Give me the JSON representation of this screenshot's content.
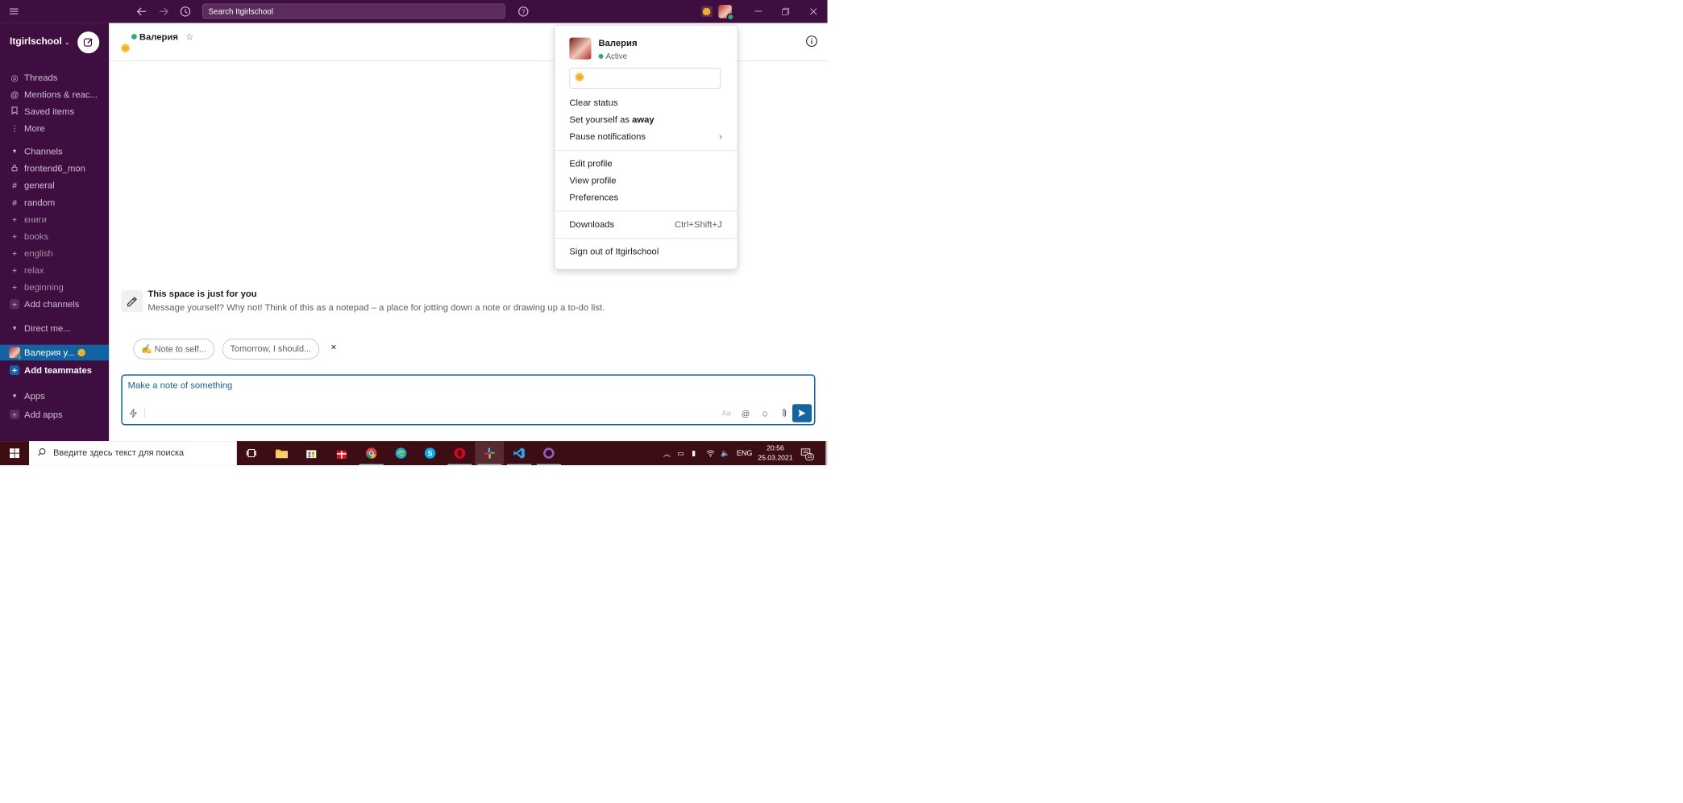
{
  "topbar": {
    "search_placeholder": "Search Itgirlschool"
  },
  "workspace": {
    "name": "Itgirlschool"
  },
  "sidebar": {
    "nav": [
      {
        "label": "Threads",
        "icon": "threads-icon"
      },
      {
        "label": "Mentions & reac...",
        "icon": "at-icon"
      },
      {
        "label": "Saved items",
        "icon": "bookmark-icon"
      },
      {
        "label": "More",
        "icon": "more-vertical-icon"
      }
    ],
    "channels_header": "Channels",
    "channels": [
      {
        "prefix": "🔒",
        "label": "frontend6_mon"
      },
      {
        "prefix": "#",
        "label": "general"
      },
      {
        "prefix": "#",
        "label": "random"
      },
      {
        "prefix": "+",
        "label": "книги"
      },
      {
        "prefix": "+",
        "label": "books"
      },
      {
        "prefix": "+",
        "label": "english"
      },
      {
        "prefix": "+",
        "label": "relax"
      },
      {
        "prefix": "+",
        "label": "beginning"
      }
    ],
    "add_channels": "Add channels",
    "dm_header": "Direct me...",
    "dm_self": "Валерия   y...",
    "add_teammates": "Add teammates",
    "apps_header": "Apps",
    "add_apps": "Add apps"
  },
  "channel": {
    "name": "Валерия",
    "status_emoji": "🌼"
  },
  "intro": {
    "title": "This space is just for you",
    "text": "Message yourself? Why not! Think of this as a notepad – a place for jotting down a note or drawing up a to-do list."
  },
  "chips": [
    {
      "label": "✍️  Note to self..."
    },
    {
      "label": "Tomorrow, I should..."
    }
  ],
  "chips_close": "×",
  "composer": {
    "placeholder": "Make a note of something",
    "format_label": "Aa"
  },
  "profile_menu": {
    "name": "Валерия",
    "status": "Active",
    "status_emoji": "🌼",
    "clear_status": "Clear status",
    "set_away_prefix": "Set yourself as ",
    "set_away_bold": "away",
    "pause_notifications": "Pause notifications",
    "edit_profile": "Edit profile",
    "view_profile": "View profile",
    "preferences": "Preferences",
    "downloads": "Downloads",
    "downloads_shortcut": "Ctrl+Shift+J",
    "sign_out": "Sign out of Itgirlschool"
  },
  "taskbar": {
    "search_placeholder": "Введите здесь текст для поиска",
    "lang": "ENG",
    "time": "20:56",
    "date": "25.03.2021",
    "notif_count": "15"
  },
  "colors": {
    "sidebar_bg": "#3f0e40",
    "active_blue": "#1264a3",
    "presence_green": "#2bac76",
    "taskbar_bg": "#3d0d14"
  }
}
